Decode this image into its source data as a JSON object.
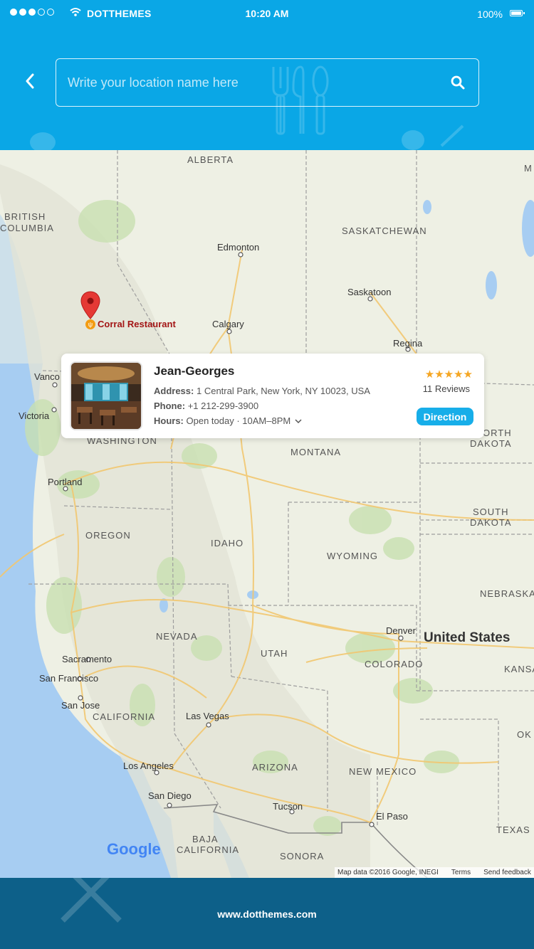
{
  "status_bar": {
    "carrier": "DOTTHEMES",
    "time": "10:20 AM",
    "battery": "100%"
  },
  "search": {
    "placeholder": "Write your location name here"
  },
  "map": {
    "pin_label": "Corral Restaurant",
    "labels": {
      "alberta": "ALBERTA",
      "british": "BRITISH",
      "columbia": "COLUMBIA",
      "saskatchewan": "SASKATCHEWAN",
      "edmonton": "Edmonton",
      "saskatoon": "Saskatoon",
      "calgary": "Calgary",
      "regina": "Regina",
      "vanco": "Vanco",
      "victoria": "Victoria",
      "washington": "WASHINGTON",
      "montana": "MONTANA",
      "orth": "ORTH",
      "dakota_n": "DAKOTA",
      "portland": "Portland",
      "oregon": "OREGON",
      "idaho": "IDAHO",
      "wyoming": "WYOMING",
      "south": "SOUTH",
      "dakota_s": "DAKOTA",
      "nebraska": "NEBRASKA",
      "nevada": "NEVADA",
      "denver": "Denver",
      "united_states": "United States",
      "kansa": "KANSA",
      "utah": "UTAH",
      "colorado": "COLORADO",
      "sacramento": "Sacramento",
      "san_francisco": "San Francisco",
      "san_jose": "San Jose",
      "california": "CALIFORNIA",
      "las_vegas": "Las Vegas",
      "los_angeles": "Los Angeles",
      "arizona": "ARIZONA",
      "new_mexico": "NEW MEXICO",
      "okl": "OK",
      "san_diego": "San Diego",
      "tucson": "Tucson",
      "el_paso": "El Paso",
      "texas": "TEXAS",
      "baja": "BAJA",
      "baja_cal": "CALIFORNIA",
      "sonora": "SONORA",
      "m_edge": "M"
    },
    "google_logo": "Google",
    "attribution": {
      "map_data": "Map data ©2016 Google, INEGI",
      "terms": "Terms",
      "feedback": "Send feedback"
    }
  },
  "card": {
    "name": "Jean-Georges",
    "address_label": "Address:",
    "address": "1 Central Park, New York, NY 10023, USA",
    "phone_label": "Phone:",
    "phone": "+1 212-299-3900",
    "hours_label": "Hours:",
    "hours": "Open today · 10AM–8PM",
    "rating": 5,
    "stars": "★★★★★",
    "reviews": "11 Reviews",
    "direction_label": "Direction"
  },
  "footer": {
    "text": "www.dotthemes.com"
  },
  "colors": {
    "header": "#0aa7e6",
    "footer": "#0d6089",
    "accent": "#17aee9",
    "star": "#f5a623",
    "pin": "#e53935",
    "pin_label": "#a31515"
  }
}
